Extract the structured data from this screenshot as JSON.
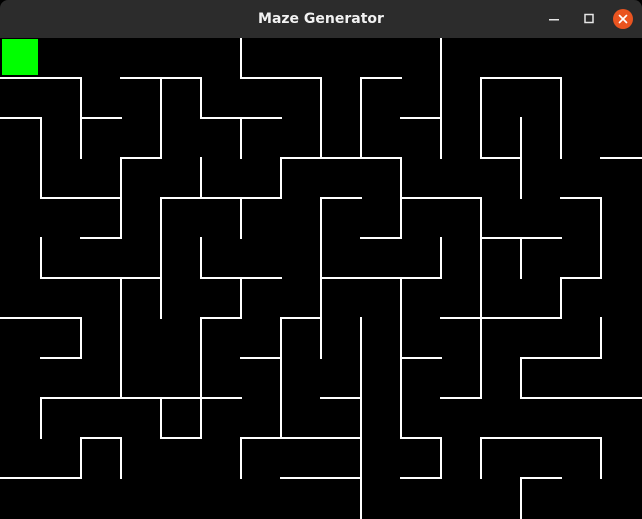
{
  "window": {
    "title": "Maze Generator",
    "controls": [
      {
        "name": "minimize-button",
        "icon": "minimize-icon"
      },
      {
        "name": "maximize-button",
        "icon": "maximize-icon"
      },
      {
        "name": "close-button",
        "icon": "close-icon"
      }
    ],
    "colors": {
      "titlebar": "#2c2c2c",
      "title_text": "#f2f2f2",
      "close_button": "#e95420",
      "maze_background": "#000000",
      "maze_walls": "#ffffff",
      "player_marker": "#00ff00"
    }
  },
  "maze": {
    "columns": 16,
    "rows": 12,
    "player_cell": [
      0,
      0
    ],
    "walls": [
      [
        0,
        1,
        1,
        1
      ],
      [
        1,
        1,
        2,
        1
      ],
      [
        2,
        1,
        2,
        3
      ],
      [
        2,
        2,
        3,
        2
      ],
      [
        3,
        1,
        5,
        1
      ],
      [
        5,
        1,
        5,
        2
      ],
      [
        5,
        2,
        7,
        2
      ],
      [
        6,
        2,
        6,
        3
      ],
      [
        6,
        0,
        6,
        1
      ],
      [
        6,
        1,
        8,
        1
      ],
      [
        8,
        1,
        8,
        3
      ],
      [
        9,
        1,
        10,
        1
      ],
      [
        9,
        1,
        9,
        3
      ],
      [
        10,
        2,
        11,
        2
      ],
      [
        11,
        0,
        11,
        3
      ],
      [
        12,
        1,
        14,
        1
      ],
      [
        12,
        1,
        12,
        3
      ],
      [
        12,
        3,
        13,
        3
      ],
      [
        13,
        2,
        13,
        4
      ],
      [
        14,
        1,
        14,
        3
      ],
      [
        15,
        3,
        16,
        3
      ],
      [
        4,
        1,
        4,
        3
      ],
      [
        3,
        3,
        4,
        3
      ],
      [
        3,
        3,
        3,
        5
      ],
      [
        0,
        2,
        1,
        2
      ],
      [
        1,
        2,
        1,
        4
      ],
      [
        1,
        4,
        3,
        4
      ],
      [
        2,
        5,
        3,
        5
      ],
      [
        5,
        3,
        5,
        4
      ],
      [
        4,
        4,
        7,
        4
      ],
      [
        4,
        4,
        4,
        7
      ],
      [
        6,
        4,
        6,
        5
      ],
      [
        7,
        3,
        10,
        3
      ],
      [
        7,
        3,
        7,
        4
      ],
      [
        10,
        3,
        10,
        5
      ],
      [
        10,
        4,
        12,
        4
      ],
      [
        9,
        5,
        10,
        5
      ],
      [
        8,
        4,
        9,
        4
      ],
      [
        8,
        4,
        8,
        8
      ],
      [
        12,
        4,
        12,
        9
      ],
      [
        12,
        5,
        14,
        5
      ],
      [
        13,
        5,
        13,
        6
      ],
      [
        14,
        4,
        15,
        4
      ],
      [
        15,
        4,
        15,
        6
      ],
      [
        14,
        6,
        15,
        6
      ],
      [
        14,
        6,
        14,
        7
      ],
      [
        12,
        7,
        14,
        7
      ],
      [
        1,
        5,
        1,
        6
      ],
      [
        1,
        6,
        4,
        6
      ],
      [
        5,
        5,
        5,
        6
      ],
      [
        5,
        6,
        7,
        6
      ],
      [
        6,
        6,
        6,
        7
      ],
      [
        5,
        7,
        6,
        7
      ],
      [
        8,
        6,
        11,
        6
      ],
      [
        11,
        5,
        11,
        6
      ],
      [
        3,
        6,
        3,
        9
      ],
      [
        0,
        7,
        2,
        7
      ],
      [
        2,
        7,
        2,
        8
      ],
      [
        1,
        8,
        2,
        8
      ],
      [
        5,
        7,
        5,
        10
      ],
      [
        4,
        9,
        6,
        9
      ],
      [
        4,
        9,
        4,
        10
      ],
      [
        4,
        10,
        5,
        10
      ],
      [
        7,
        7,
        8,
        7
      ],
      [
        7,
        7,
        7,
        10
      ],
      [
        6,
        8,
        7,
        8
      ],
      [
        8,
        9,
        9,
        9
      ],
      [
        9,
        7,
        9,
        12
      ],
      [
        10,
        6,
        10,
        10
      ],
      [
        10,
        8,
        11,
        8
      ],
      [
        10,
        10,
        11,
        10
      ],
      [
        11,
        9,
        12,
        9
      ],
      [
        11,
        7,
        12,
        7
      ],
      [
        11,
        10,
        11,
        11
      ],
      [
        10,
        11,
        11,
        11
      ],
      [
        15,
        7,
        15,
        8
      ],
      [
        13,
        8,
        15,
        8
      ],
      [
        13,
        8,
        13,
        9
      ],
      [
        13,
        9,
        16,
        9
      ],
      [
        1,
        9,
        1,
        10
      ],
      [
        1,
        9,
        4,
        9
      ],
      [
        3,
        10,
        3,
        11
      ],
      [
        2,
        10,
        3,
        10
      ],
      [
        2,
        10,
        2,
        11
      ],
      [
        0,
        11,
        2,
        11
      ],
      [
        6,
        10,
        9,
        10
      ],
      [
        6,
        10,
        6,
        11
      ],
      [
        7,
        11,
        9,
        11
      ],
      [
        12,
        10,
        15,
        10
      ],
      [
        15,
        10,
        15,
        11
      ],
      [
        12,
        10,
        12,
        11
      ],
      [
        13,
        11,
        14,
        11
      ],
      [
        13,
        11,
        13,
        12
      ]
    ]
  }
}
